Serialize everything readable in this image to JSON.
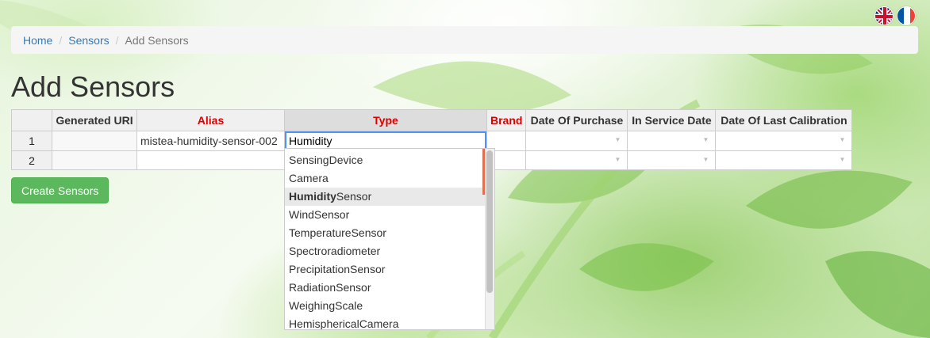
{
  "languages": [
    {
      "code": "en",
      "icon": "uk-flag-icon"
    },
    {
      "code": "fr",
      "icon": "france-flag-icon"
    }
  ],
  "breadcrumb": {
    "home": "Home",
    "sensors": "Sensors",
    "current": "Add Sensors"
  },
  "page_title": "Add Sensors",
  "table": {
    "columns": [
      {
        "label": "",
        "required": false
      },
      {
        "label": "Generated URI",
        "required": false
      },
      {
        "label": "Alias",
        "required": true
      },
      {
        "label": "Type",
        "required": true
      },
      {
        "label": "Brand",
        "required": true
      },
      {
        "label": "Date Of Purchase",
        "required": false
      },
      {
        "label": "In Service Date",
        "required": false
      },
      {
        "label": "Date Of Last Calibration",
        "required": false
      }
    ],
    "rows": [
      {
        "num": "1",
        "uri": "",
        "alias": "mistea-humidity-sensor-002",
        "type": "Humidity",
        "brand": ""
      },
      {
        "num": "2",
        "uri": "",
        "alias": "",
        "type": "",
        "brand": ""
      }
    ],
    "dropdown_arrow": "▼"
  },
  "type_dropdown": {
    "query": "Humidity",
    "options": [
      {
        "match": "",
        "rest": "SensingDevice"
      },
      {
        "match": "",
        "rest": "Camera"
      },
      {
        "match": "Humidity",
        "rest": "Sensor",
        "highlighted": true
      },
      {
        "match": "",
        "rest": "WindSensor"
      },
      {
        "match": "",
        "rest": "TemperatureSensor"
      },
      {
        "match": "",
        "rest": "Spectroradiometer"
      },
      {
        "match": "",
        "rest": "PrecipitationSensor"
      },
      {
        "match": "",
        "rest": "RadiationSensor"
      },
      {
        "match": "",
        "rest": "WeighingScale"
      },
      {
        "match": "",
        "rest": "HemisphericalCamera"
      }
    ]
  },
  "create_button": "Create Sensors",
  "colors": {
    "link": "#337ab7",
    "required": "#dd0000",
    "button": "#5cb85c",
    "editor_border": "#5292f7"
  }
}
